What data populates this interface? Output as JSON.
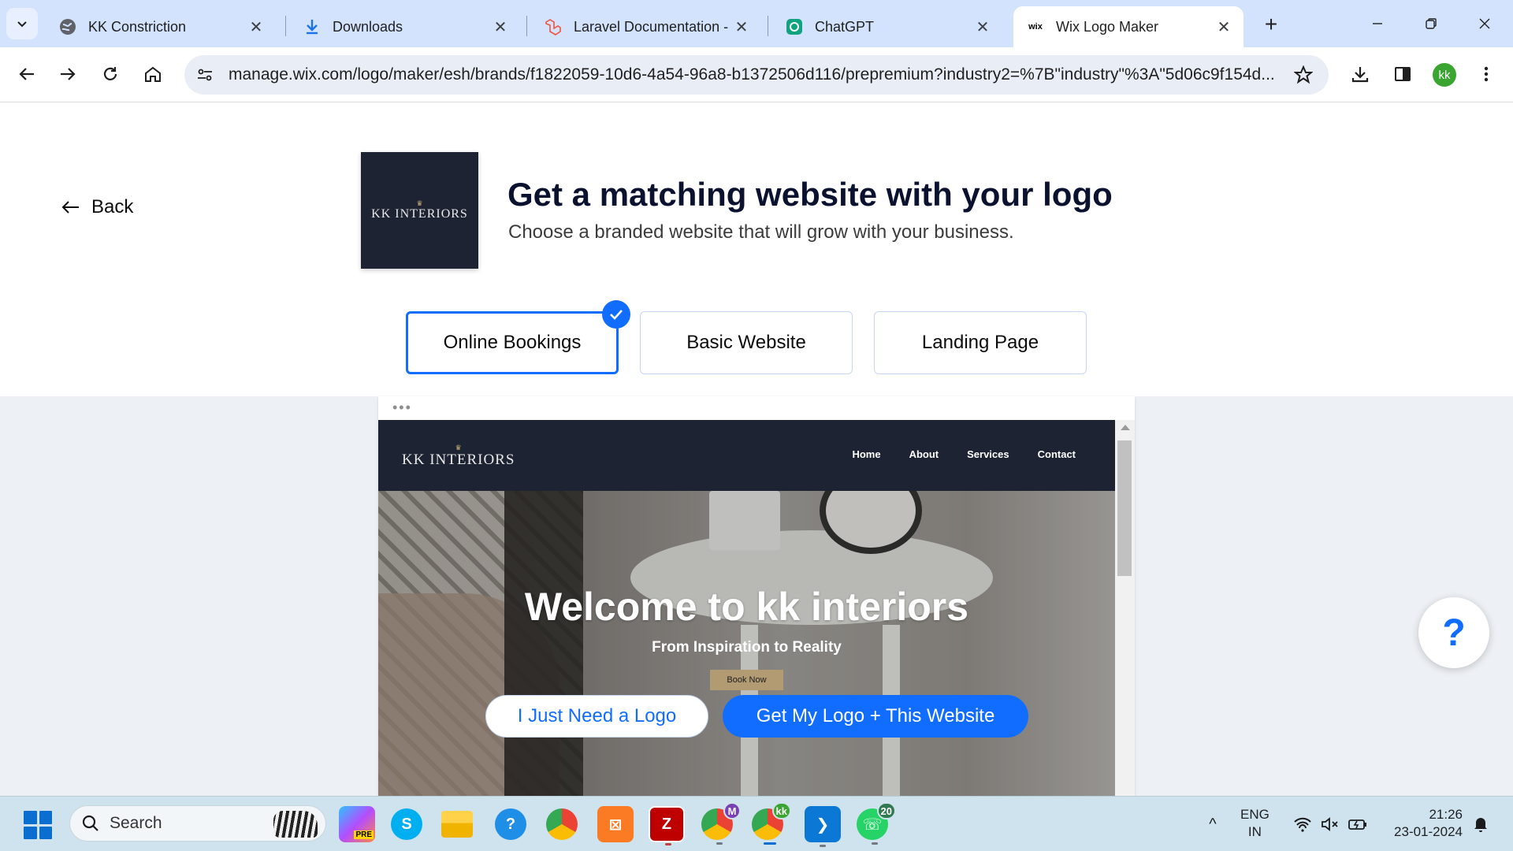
{
  "browser": {
    "tabs": [
      {
        "title": "KK Constriction",
        "icon": "globe-icon"
      },
      {
        "title": "Downloads",
        "icon": "download-icon"
      },
      {
        "title": "Laravel Documentation -",
        "icon": "laravel-icon"
      },
      {
        "title": "ChatGPT",
        "icon": "chatgpt-icon"
      },
      {
        "title": "Wix Logo Maker",
        "icon": "wix-icon",
        "icon_text": "wix",
        "active": true
      }
    ],
    "url": "manage.wix.com/logo/maker/esh/brands/f1822059-10d6-4a54-96a8-b1372506d116/prepremium?industry2=%7B\"industry\"%3A\"5d06c9f154d...",
    "profile_initials": "kk"
  },
  "page": {
    "back_label": "Back",
    "logo_card": {
      "crown": "♛",
      "brand": "KK INTERIORS"
    },
    "headline": "Get a matching website with your logo",
    "subline": "Choose a branded website that will grow with your business.",
    "options": [
      {
        "label": "Online Bookings",
        "selected": true
      },
      {
        "label": "Basic Website",
        "selected": false
      },
      {
        "label": "Landing Page",
        "selected": false
      }
    ],
    "preview": {
      "dots": "•••",
      "logo_crown": "♛",
      "logo_text": "KK INTERIORS",
      "nav": [
        "Home",
        "About",
        "Services",
        "Contact"
      ],
      "hero_title": "Welcome to kk interiors",
      "hero_subtitle": "From Inspiration to Reality",
      "hero_button": "Book Now"
    },
    "buttons": {
      "logo_only": "I Just Need a Logo",
      "logo_website": "Get My Logo + This Website"
    },
    "help_label": "?"
  },
  "taskbar": {
    "search_label": "Search",
    "apps": [
      {
        "name": "copilot",
        "label": "PRE"
      },
      {
        "name": "skype",
        "label": "S"
      },
      {
        "name": "file-explorer",
        "label": ""
      },
      {
        "name": "get-help",
        "label": "?"
      },
      {
        "name": "chrome",
        "label": ""
      },
      {
        "name": "xampp",
        "label": "⊠"
      },
      {
        "name": "filezilla",
        "label": "Z"
      },
      {
        "name": "chrome-profile-m",
        "label": "M"
      },
      {
        "name": "chrome-profile-kk",
        "label": "kk"
      },
      {
        "name": "vscode",
        "label": "❯"
      },
      {
        "name": "whatsapp",
        "label": "☏",
        "badge": "20"
      }
    ],
    "tray": {
      "chevron": "^",
      "lang_line1": "ENG",
      "lang_line2": "IN",
      "time": "21:26",
      "date": "23-01-2024"
    }
  },
  "colors": {
    "accent": "#116dff",
    "tab_strip": "#d3e3fd",
    "logo_bg": "#1d2332",
    "taskbar": "#cfe3ee"
  }
}
